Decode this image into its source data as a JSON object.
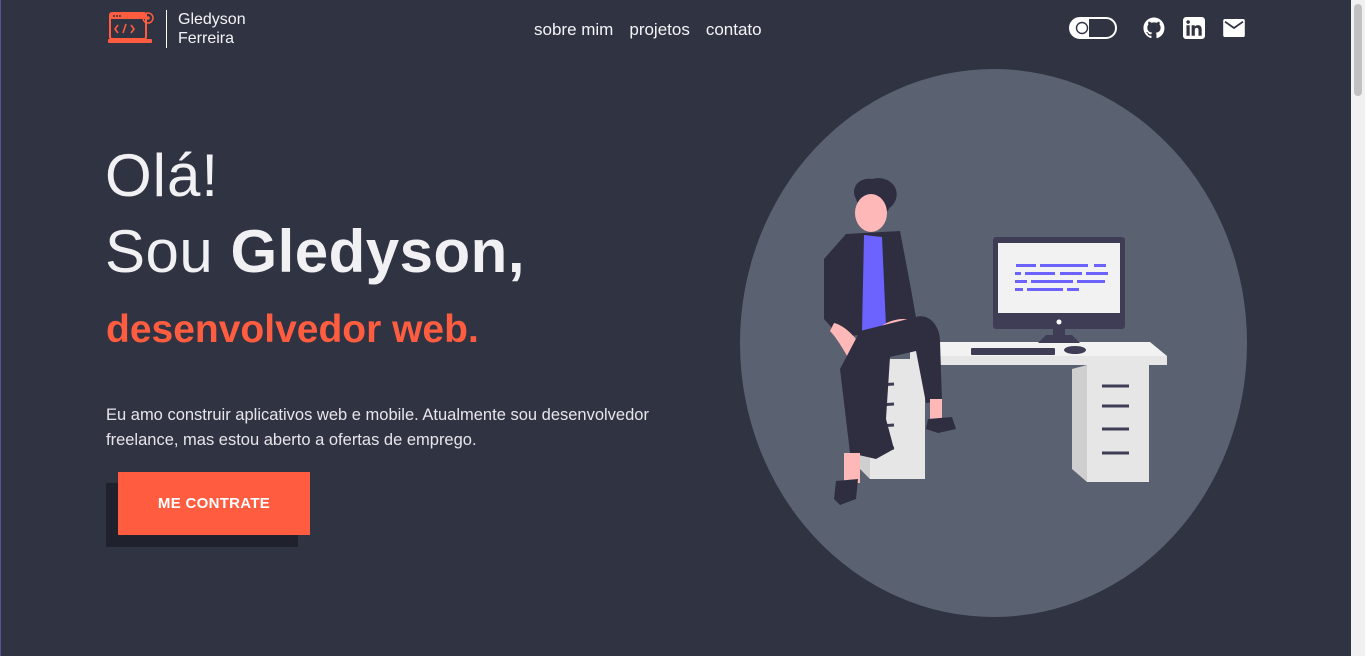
{
  "header": {
    "logo_icon": "developer-laptop-icon",
    "name_line1": "Gledyson",
    "name_line2": "Ferreira",
    "nav": [
      {
        "label": "sobre mim"
      },
      {
        "label": "projetos"
      },
      {
        "label": "contato"
      }
    ],
    "icons": [
      "theme-toggle-icon",
      "github-icon",
      "linkedin-icon",
      "mail-icon"
    ]
  },
  "hero": {
    "greeting": "Olá!",
    "intro_prefix": "Sou ",
    "intro_name": "Gledyson,",
    "role": "desenvolvedor web.",
    "description": "Eu amo construir aplicativos web e mobile. Atualmente sou desenvolvedor freelance, mas estou aberto a ofertas de emprego.",
    "cta_label": "ME CONTRATE",
    "illustration": "developer-at-desk-illustration"
  },
  "colors": {
    "background": "#303342",
    "accent": "#ff5c40",
    "circle": "#5a6272",
    "screen_code": "#6c63ff"
  }
}
